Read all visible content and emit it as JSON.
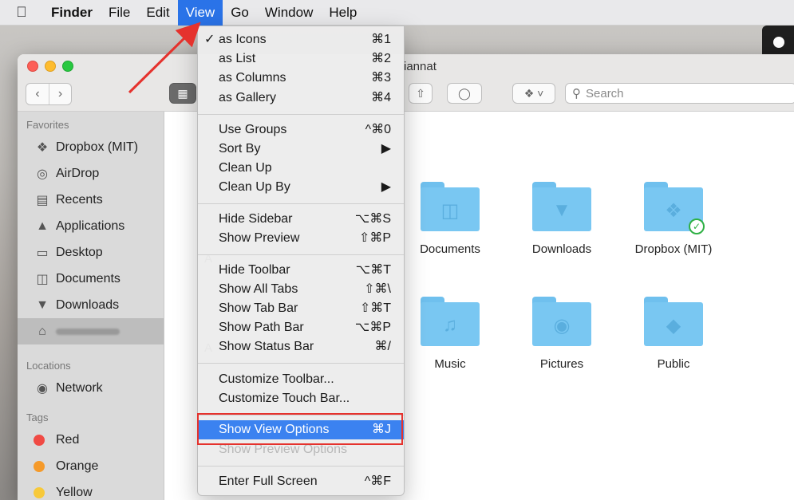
{
  "menubar": {
    "app": "Finder",
    "items": [
      "File",
      "Edit",
      "View",
      "Go",
      "Window",
      "Help"
    ],
    "active": "View"
  },
  "window": {
    "title": "iannat",
    "search_placeholder": "Search"
  },
  "sidebar": {
    "favorites_header": "Favorites",
    "favorites": [
      {
        "label": "Dropbox (MIT)",
        "icon": "dropbox-icon"
      },
      {
        "label": "AirDrop",
        "icon": "airdrop-icon"
      },
      {
        "label": "Recents",
        "icon": "recents-icon"
      },
      {
        "label": "Applications",
        "icon": "applications-icon"
      },
      {
        "label": "Desktop",
        "icon": "desktop-icon"
      },
      {
        "label": "Documents",
        "icon": "documents-icon"
      },
      {
        "label": "Downloads",
        "icon": "downloads-icon"
      }
    ],
    "locations_header": "Locations",
    "locations": [
      {
        "label": "Network",
        "icon": "network-icon"
      }
    ],
    "tags_header": "Tags",
    "tags": [
      {
        "label": "Red",
        "color": "#f04a44"
      },
      {
        "label": "Orange",
        "color": "#f59a2a"
      },
      {
        "label": "Yellow",
        "color": "#f7c93a"
      }
    ]
  },
  "content": {
    "items": [
      {
        "label": "Documents",
        "icon": "documents-folder-icon"
      },
      {
        "label": "Downloads",
        "icon": "downloads-folder-icon"
      },
      {
        "label": "Dropbox (MIT)",
        "icon": "dropbox-folder-icon"
      },
      {
        "label": "Music",
        "icon": "music-folder-icon"
      },
      {
        "label": "Pictures",
        "icon": "pictures-folder-icon"
      },
      {
        "label": "Public",
        "icon": "public-folder-icon"
      }
    ],
    "partial_a1": "A",
    "partial_a2": "A"
  },
  "view_menu": {
    "group1": [
      {
        "label": "as Icons",
        "shortcut": "⌘1",
        "checked": true
      },
      {
        "label": "as List",
        "shortcut": "⌘2"
      },
      {
        "label": "as Columns",
        "shortcut": "⌘3"
      },
      {
        "label": "as Gallery",
        "shortcut": "⌘4"
      }
    ],
    "group2": [
      {
        "label": "Use Groups",
        "shortcut": "^⌘0"
      },
      {
        "label": "Sort By",
        "shortcut": "▶"
      },
      {
        "label": "Clean Up",
        "shortcut": ""
      },
      {
        "label": "Clean Up By",
        "shortcut": "▶"
      }
    ],
    "group3": [
      {
        "label": "Hide Sidebar",
        "shortcut": "⌥⌘S"
      },
      {
        "label": "Show Preview",
        "shortcut": "⇧⌘P"
      }
    ],
    "group4": [
      {
        "label": "Hide Toolbar",
        "shortcut": "⌥⌘T"
      },
      {
        "label": "Show All Tabs",
        "shortcut": "⇧⌘\\"
      },
      {
        "label": "Show Tab Bar",
        "shortcut": "⇧⌘T"
      },
      {
        "label": "Show Path Bar",
        "shortcut": "⌥⌘P"
      },
      {
        "label": "Show Status Bar",
        "shortcut": "⌘/"
      }
    ],
    "group5": [
      {
        "label": "Customize Toolbar...",
        "shortcut": ""
      },
      {
        "label": "Customize Touch Bar...",
        "shortcut": ""
      }
    ],
    "group6": [
      {
        "label": "Show View Options",
        "shortcut": "⌘J",
        "highlighted": true
      },
      {
        "label": "Show Preview Options",
        "shortcut": "",
        "disabled": true
      }
    ],
    "group7": [
      {
        "label": "Enter Full Screen",
        "shortcut": "^⌘F"
      }
    ]
  },
  "colors": {
    "menu_highlight": "#3b82f0",
    "annotation_red": "#e5322d",
    "folder_blue": "#79c7f2"
  }
}
